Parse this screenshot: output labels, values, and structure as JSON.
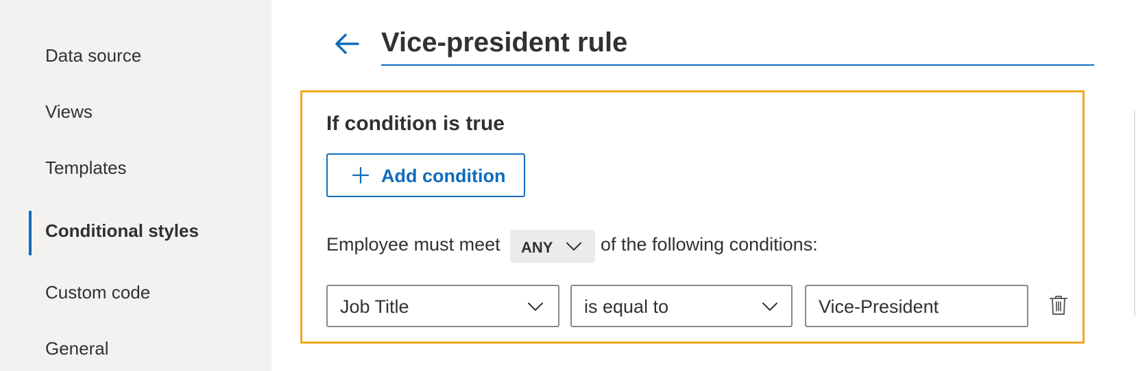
{
  "sidebar": {
    "items": [
      {
        "label": "Data source"
      },
      {
        "label": "Views"
      },
      {
        "label": "Templates"
      },
      {
        "label": "Conditional styles",
        "active": true
      },
      {
        "label": "Custom code"
      },
      {
        "label": "General"
      }
    ]
  },
  "header": {
    "title": "Vice-president rule",
    "back_icon": "back-arrow-icon"
  },
  "condition_panel": {
    "heading": "If condition is true",
    "add_condition_label": "Add condition",
    "match_prefix": "Employee must meet",
    "match_value": "ANY",
    "match_suffix": "of the following conditions:",
    "conditions": [
      {
        "field": "Job Title",
        "operator": "is equal to",
        "value": "Vice-President"
      }
    ]
  },
  "colors": {
    "accent": "#0f6cbd",
    "highlight_border": "#f0a81c",
    "sidebar_bg": "#f3f2f1",
    "text": "#323130"
  }
}
